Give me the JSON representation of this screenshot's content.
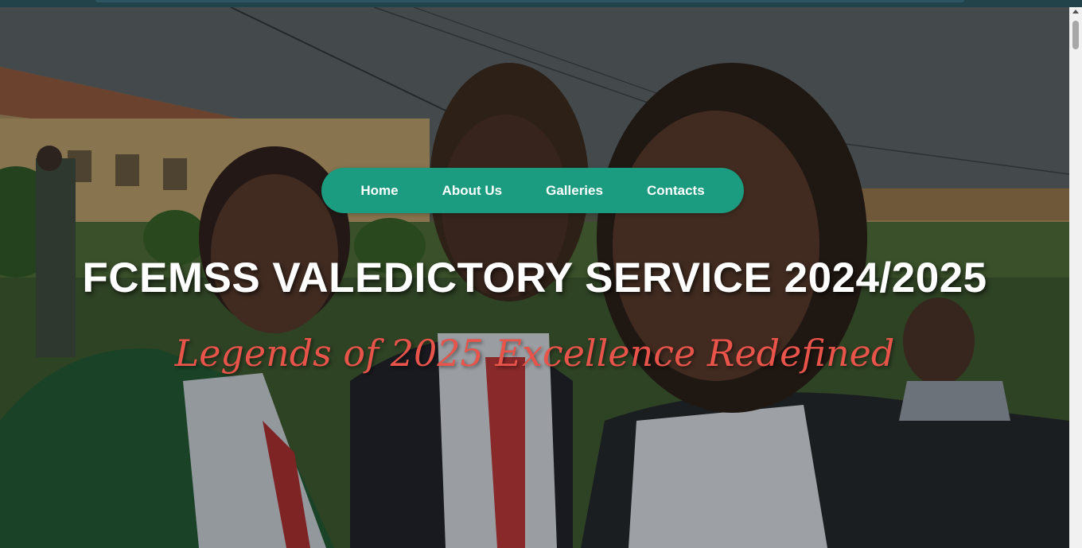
{
  "nav": {
    "items": [
      {
        "label": "Home"
      },
      {
        "label": "About Us"
      },
      {
        "label": "Galleries"
      },
      {
        "label": "Contacts"
      }
    ]
  },
  "hero": {
    "title": "FCEMSS VALEDICTORY SERVICE 2024/2025",
    "subtitle": "Legends of 2025 Excellence Redefined"
  },
  "colors": {
    "nav_bg": "#1b9b7f",
    "subtitle": "#e8534a",
    "title": "#ffffff"
  }
}
